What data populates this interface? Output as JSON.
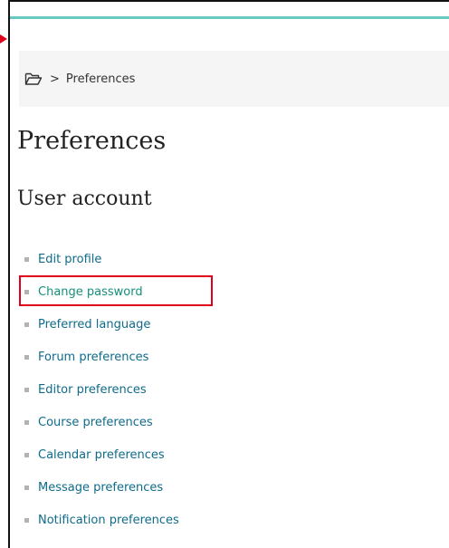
{
  "colors": {
    "accent_bar": "#68c8c2",
    "link": "#0f6b8a",
    "highlighted_link": "#14907a",
    "highlight_box": "#e0001b",
    "breadcrumb_bg": "#f5f5f5"
  },
  "breadcrumb": {
    "home_icon": "folder-open-icon",
    "separator": ">",
    "current": "Preferences"
  },
  "page": {
    "title": "Preferences"
  },
  "user_account": {
    "heading": "User account",
    "links": [
      {
        "label": "Edit profile"
      },
      {
        "label": "Change password",
        "highlighted": true
      },
      {
        "label": "Preferred language"
      },
      {
        "label": "Forum preferences"
      },
      {
        "label": "Editor preferences"
      },
      {
        "label": "Course preferences"
      },
      {
        "label": "Calendar preferences"
      },
      {
        "label": "Message preferences"
      },
      {
        "label": "Notification preferences"
      }
    ]
  }
}
